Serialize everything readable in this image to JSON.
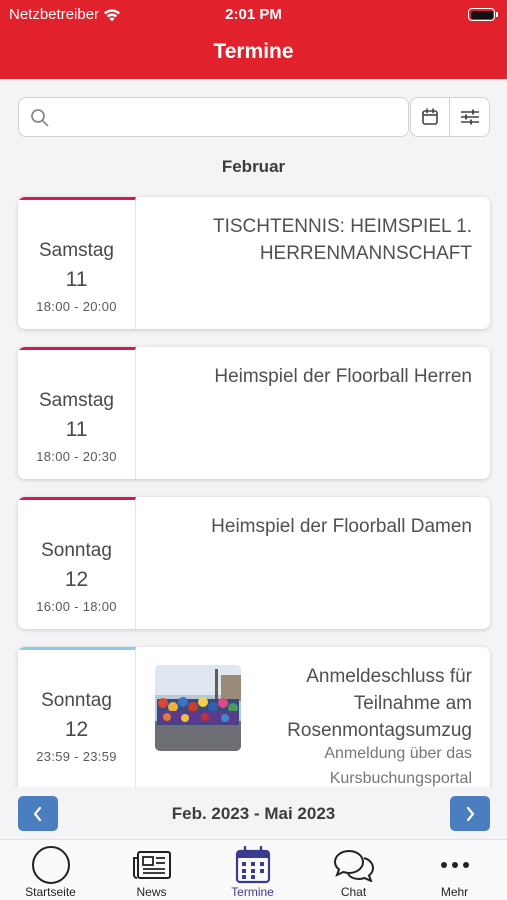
{
  "status_bar": {
    "carrier": "Netzbetreiber",
    "time": "2:01 PM"
  },
  "header": {
    "title": "Termine"
  },
  "search": {
    "placeholder": "",
    "value": ""
  },
  "toolbar": {
    "calendar_icon": "calendar-icon",
    "filter_icon": "sliders-icon"
  },
  "month_label": "Februar",
  "events": [
    {
      "day": "Samstag",
      "date": "11",
      "time": "18:00 - 20:00",
      "title": "TISCHTENNIS: HEIMSPIEL 1. HERRENMANNSCHAFT",
      "accent": "#d61a50"
    },
    {
      "day": "Samstag",
      "date": "11",
      "time": "18:00 - 20:30",
      "title": "Heimspiel der Floorball Herren",
      "accent": "#d61a50"
    },
    {
      "day": "Sonntag",
      "date": "12",
      "time": "16:00 - 18:00",
      "title": "Heimspiel der Floorball Damen",
      "accent": "#d61a50"
    },
    {
      "day": "Sonntag",
      "date": "12",
      "time": "23:59 - 23:59",
      "title": "Anmeldeschluss für Teilnahme am Rosenmontagsumzug",
      "subtitle": "Anmeldung über das Kursbuchungsportal",
      "accent": "#8ccbee",
      "has_image": true
    }
  ],
  "range": {
    "label": "Feb. 2023 - Mai 2023",
    "prev_icon": "chevron-left-icon",
    "next_icon": "chevron-right-icon"
  },
  "tabs": [
    {
      "label": "Startseite",
      "icon": "circle-icon",
      "active": false
    },
    {
      "label": "News",
      "icon": "newspaper-icon",
      "active": false
    },
    {
      "label": "Termine",
      "icon": "calendar-icon",
      "active": true
    },
    {
      "label": "Chat",
      "icon": "chat-bubbles-icon",
      "active": false
    },
    {
      "label": "Mehr",
      "icon": "more-dots-icon",
      "active": false
    }
  ],
  "colors": {
    "header": "#e1212b",
    "accent_red": "#d61a50",
    "accent_blue": "#8ccbee",
    "nav_button": "#4a7ebf",
    "active_tab": "#3b3b8f"
  }
}
